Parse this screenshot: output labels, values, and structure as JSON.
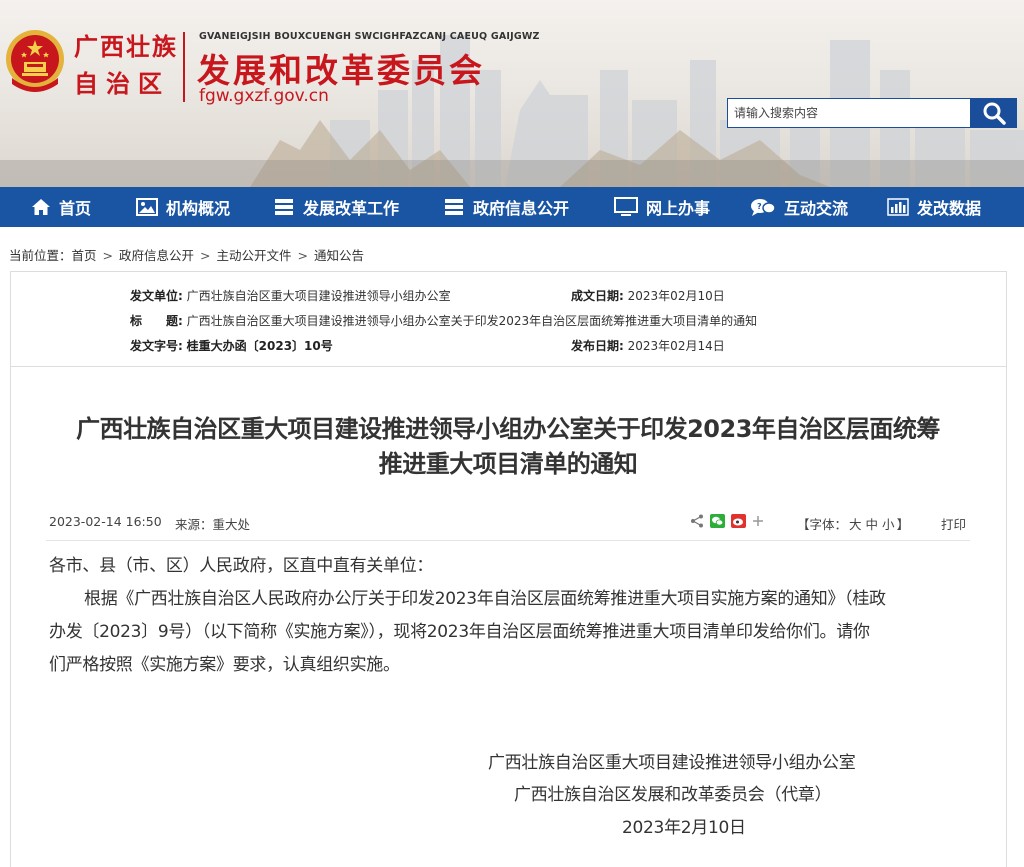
{
  "header": {
    "region_line1": "广西壮族",
    "region_line2": "自治区",
    "zhuang_name": "GVANEIGJSIH BOUXCUENGH SWCIGHFAZCANJ CAEUQ GAIJGWZ",
    "org_title": "发展和改革委员会",
    "domain": "fgw.gxzf.gov.cn",
    "search_placeholder": "请输入搜索内容"
  },
  "nav": {
    "items": [
      {
        "label": "首页",
        "icon": "home-icon"
      },
      {
        "label": "机构概况",
        "icon": "image-icon"
      },
      {
        "label": "发展改革工作",
        "icon": "stack-icon"
      },
      {
        "label": "政府信息公开",
        "icon": "stack-icon"
      },
      {
        "label": "网上办事",
        "icon": "monitor-icon"
      },
      {
        "label": "互动交流",
        "icon": "chat-icon"
      },
      {
        "label": "发改数据",
        "icon": "bar-chart-icon"
      }
    ],
    "accent": "#1a55a3"
  },
  "breadcrumb": {
    "label": "当前位置：",
    "items": [
      "首页",
      "政府信息公开",
      "主动公开文件",
      "通知公告"
    ]
  },
  "meta": {
    "issuer_label": "发文单位:",
    "issuer": "广西壮族自治区重大项目建设推进领导小组办公室",
    "created_label": "成文日期:",
    "created": "2023年02月10日",
    "title_label": "标　　题:",
    "title": "广西壮族自治区重大项目建设推进领导小组办公室关于印发2023年自治区层面统筹推进重大项目清单的通知",
    "docno_label": "发文字号:",
    "docno": "桂重大办函〔2023〕10号",
    "published_label": "发布日期:",
    "published": "2023年02月14日"
  },
  "article": {
    "title_line1": "广西壮族自治区重大项目建设推进领导小组办公室关于印发2023年自治区层面统筹",
    "title_line2": "推进重大项目清单的通知",
    "datetime": "2023-02-14 16:50",
    "source": "来源：重大处",
    "font_label": "【字体：",
    "font_large": "大",
    "font_medium": "中",
    "font_small": "小",
    "font_close": "】",
    "print": "打印",
    "salutation": "各市、县（市、区）人民政府，区直中直有关单位：",
    "para_line1": "根据《广西壮族自治区人民政府办公厅关于印发2023年自治区层面统筹推进重大项目实施方案的通知》（桂政",
    "para_line2": "办发〔2023〕9号）（以下简称《实施方案》），现将2023年自治区层面统筹推进重大项目清单印发给你们。请你",
    "para_line3": "们严格按照《实施方案》要求，认真组织实施。",
    "sign_org1": "广西壮族自治区重大项目建设推进领导小组办公室",
    "sign_org2": "广西壮族自治区发展和改革委员会（代章）",
    "sign_date": "2023年2月10日"
  },
  "colors": {
    "brand_red": "#c8161d",
    "nav_blue": "#1a55a3"
  }
}
